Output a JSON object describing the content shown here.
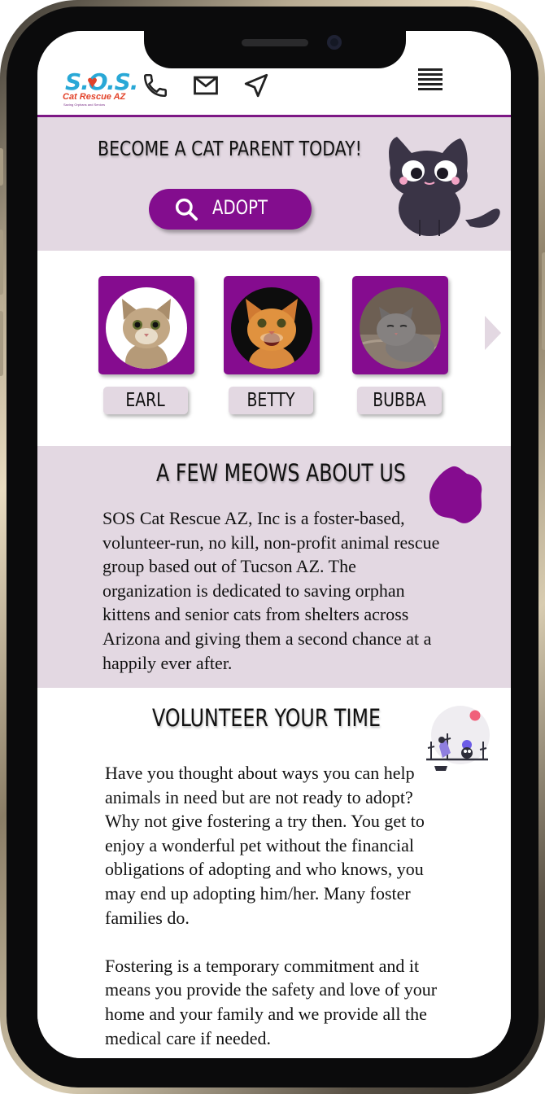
{
  "header": {
    "logo_text": "S.O.S.",
    "logo_subtitle": "Cat Rescue AZ",
    "logo_tagline": "Saving Orphans and Seniors",
    "icons": [
      "phone-icon",
      "mail-icon",
      "location-arrow-icon",
      "menu-icon"
    ]
  },
  "hero": {
    "title": "BECOME A CAT PARENT TODAY!",
    "adopt_label": "ADOPT"
  },
  "cats": [
    {
      "name": "EARL"
    },
    {
      "name": "BETTY"
    },
    {
      "name": "BUBBA"
    }
  ],
  "about": {
    "title": "A FEW MEOWS ABOUT US",
    "text": "SOS Cat Rescue AZ, Inc is a foster-based, volunteer-run, no kill, non-profit animal rescue group based out of Tucson AZ. The organization is dedicated to saving orphan kittens and senior cats from shelters across Arizona and giving them a second chance at a happily ever after."
  },
  "volunteer": {
    "title": "VOLUNTEER YOUR TIME",
    "paragraph_1": "Have you thought about ways you can help animals in need but are not ready to adopt? Why not give fostering a try then. You get to enjoy a wonderful pet without the financial obligations of adopting and who knows, you may end up adopting him/her. Many foster families do.",
    "paragraph_2": "Fostering is a temporary commitment and it means you provide the safety and love of your home and your family and we provide all the medical care if needed."
  },
  "colors": {
    "accent": "#830d8e",
    "section_bg": "#e3d8e2",
    "logo_blue": "#29a8d6",
    "logo_red": "#e2432a"
  }
}
